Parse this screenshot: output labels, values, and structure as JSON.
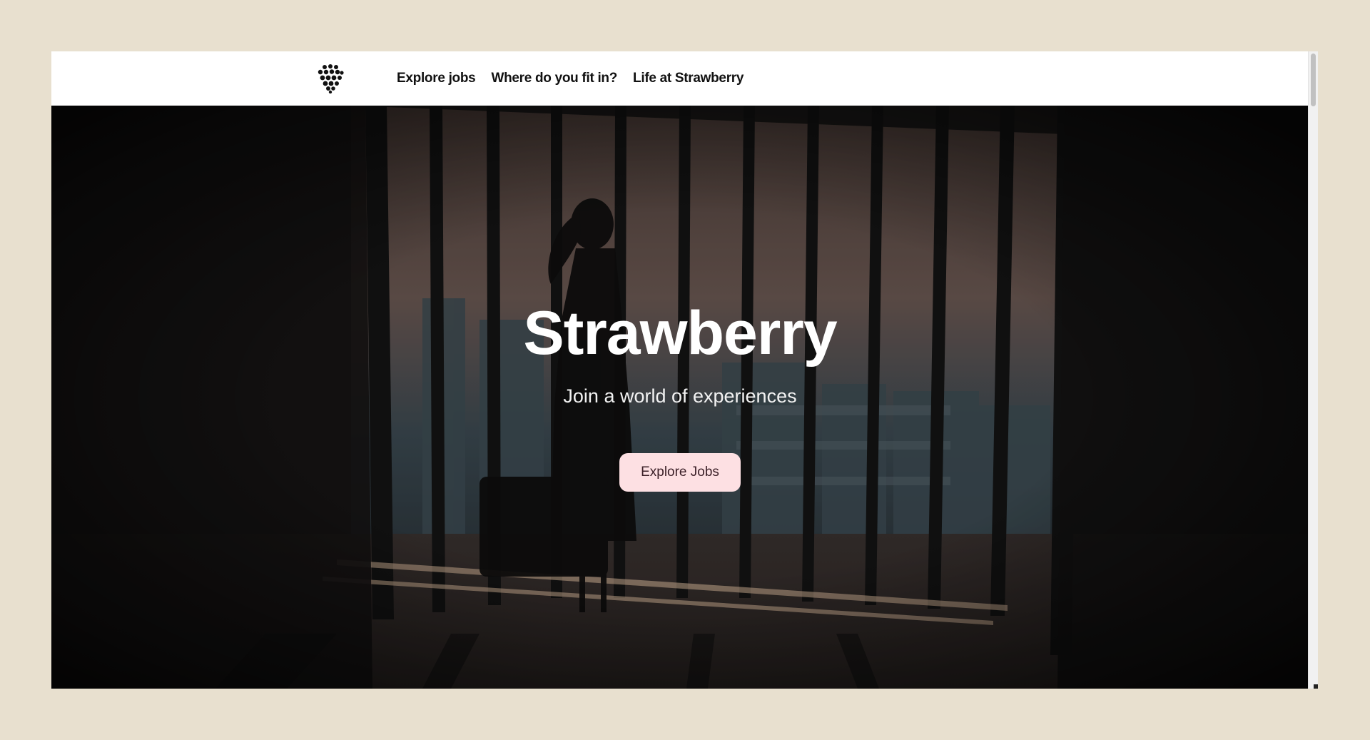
{
  "nav": {
    "logo_icon": "raspberry-logo-icon",
    "links": [
      {
        "label": "Explore jobs"
      },
      {
        "label": "Where do you fit in?"
      },
      {
        "label": "Life at Strawberry"
      }
    ]
  },
  "hero": {
    "title": "Strawberry",
    "subtitle": "Join a world of experiences",
    "cta_label": "Explore Jobs",
    "background": "hero-video-still"
  },
  "colors": {
    "page_background": "#e8e0cf",
    "cta_background": "#fde0e3",
    "cta_text": "#3a1f27",
    "hero_text": "#ffffff"
  }
}
